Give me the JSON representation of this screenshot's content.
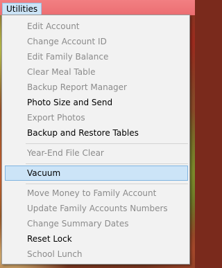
{
  "menubar": {
    "title": "Utilities"
  },
  "menu": {
    "groups": [
      [
        {
          "label": "Edit Account",
          "enabled": false
        },
        {
          "label": "Change Account ID",
          "enabled": false
        },
        {
          "label": "Edit Family Balance",
          "enabled": false
        },
        {
          "label": "Clear Meal Table",
          "enabled": false
        },
        {
          "label": "Backup Report Manager",
          "enabled": false
        },
        {
          "label": "Photo Size and Send",
          "enabled": true
        },
        {
          "label": "Export Photos",
          "enabled": false
        },
        {
          "label": "Backup and Restore Tables",
          "enabled": true
        }
      ],
      [
        {
          "label": "Year-End File Clear",
          "enabled": false
        }
      ],
      [
        {
          "label": "Vacuum",
          "enabled": true,
          "highlighted": true
        }
      ],
      [
        {
          "label": "Move Money to Family Account",
          "enabled": false
        },
        {
          "label": "Update Family Accounts Numbers",
          "enabled": false
        },
        {
          "label": "Change Summary Dates",
          "enabled": false
        },
        {
          "label": "Reset Lock",
          "enabled": true
        },
        {
          "label": "School Lunch",
          "enabled": false
        }
      ]
    ]
  },
  "colors": {
    "menubar_bg": "#ec6e72",
    "menu_bg": "#f2f2f2",
    "highlight_bg": "#cce4f7",
    "highlight_border": "#80b4e0",
    "disabled_text": "#8b8b8b",
    "enabled_text": "#000000"
  }
}
